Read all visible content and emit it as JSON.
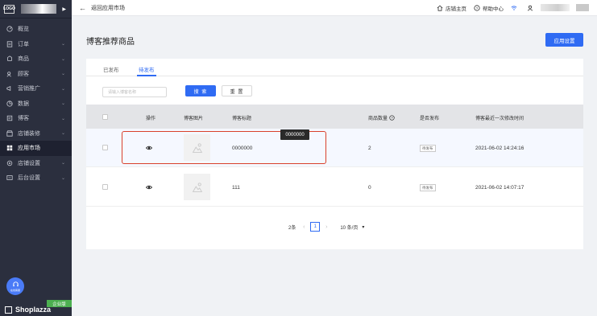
{
  "sidebar": {
    "logo_text": "LOGO",
    "items": [
      {
        "label": "概览",
        "icon": "dashboard-icon",
        "chevron": false
      },
      {
        "label": "订单",
        "icon": "order-icon",
        "chevron": true
      },
      {
        "label": "商品",
        "icon": "product-icon",
        "chevron": true
      },
      {
        "label": "顾客",
        "icon": "customer-icon",
        "chevron": true
      },
      {
        "label": "营销推广",
        "icon": "marketing-icon",
        "chevron": true
      },
      {
        "label": "数据",
        "icon": "analytics-icon",
        "chevron": true
      },
      {
        "label": "博客",
        "icon": "blog-icon",
        "chevron": true
      },
      {
        "label": "店铺装修",
        "icon": "store-design-icon",
        "chevron": true
      },
      {
        "label": "应用市场",
        "icon": "app-market-icon",
        "chevron": false,
        "active": true
      },
      {
        "label": "店铺设置",
        "icon": "store-settings-icon",
        "chevron": true
      },
      {
        "label": "后台设置",
        "icon": "admin-settings-icon",
        "chevron": true
      }
    ],
    "support_label": "在线客服",
    "plan_badge": "企业版",
    "brand": "Shoplazza"
  },
  "topbar": {
    "back_label": "返回应用市场",
    "store_home": "店铺主页",
    "help_center": "帮助中心"
  },
  "page": {
    "title": "博客推荐商品",
    "settings_button": "应用设置"
  },
  "tabs": [
    {
      "label": "已发布",
      "active": false
    },
    {
      "label": "待发布",
      "active": true
    }
  ],
  "filters": {
    "search_placeholder": "请输入博客名称",
    "search_button": "搜 索",
    "reset_button": "重 置"
  },
  "table": {
    "columns": [
      "操作",
      "博客图片",
      "博客标题",
      "商品数量",
      "是否发布",
      "博客最近一次修改时间"
    ],
    "rows": [
      {
        "title": "0000000",
        "count": "2",
        "status": "待发布",
        "modified": "2021-06-02 14:24:16"
      },
      {
        "title": "111",
        "count": "0",
        "status": "待发布",
        "modified": "2021-06-02 14:07:17"
      }
    ]
  },
  "tooltip": "0000000",
  "pagination": {
    "total": "2条",
    "current": "1",
    "page_size": "10 条/页"
  },
  "colors": {
    "primary": "#2f6bf3",
    "sidebar_bg": "#2b2f3e",
    "highlight": "#d9412b"
  }
}
